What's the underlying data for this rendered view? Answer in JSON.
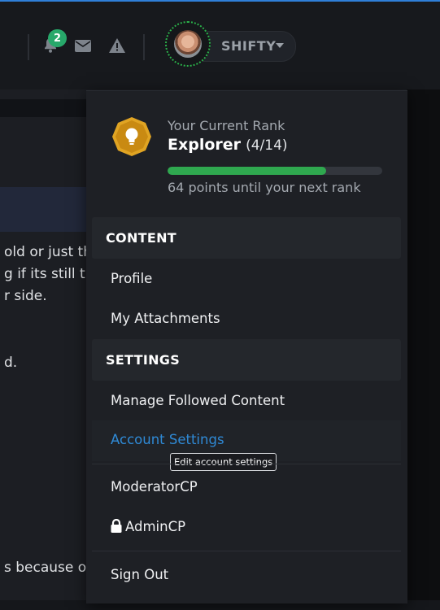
{
  "header": {
    "notification_count": "2",
    "username": "SHIFTY",
    "icons": [
      "bell-icon",
      "envelope-icon",
      "warning-icon"
    ]
  },
  "background_text": {
    "line1": "old or just th",
    "line2": "g if its still th",
    "line3": "r side.",
    "line4": "d.",
    "line5": "s because olc"
  },
  "rank": {
    "label": "Your Current Rank",
    "name": "Explorer",
    "count": "(4/14)",
    "progress": 0.74,
    "next_text": "64 points until your next rank"
  },
  "menu": {
    "content_heading": "CONTENT",
    "profile": "Profile",
    "attachments": "My Attachments",
    "settings_heading": "SETTINGS",
    "followed": "Manage Followed Content",
    "account_settings": "Account Settings",
    "tooltip": "Edit account settings",
    "moderatorcp": "ModeratorCP",
    "admincp": "AdminCP",
    "signout": "Sign Out"
  },
  "colors": {
    "accent_blue": "#2f8ad6",
    "badge_green": "#27a86a",
    "progress_green": "#2fa84f",
    "rank_gold": "#e0a423"
  }
}
